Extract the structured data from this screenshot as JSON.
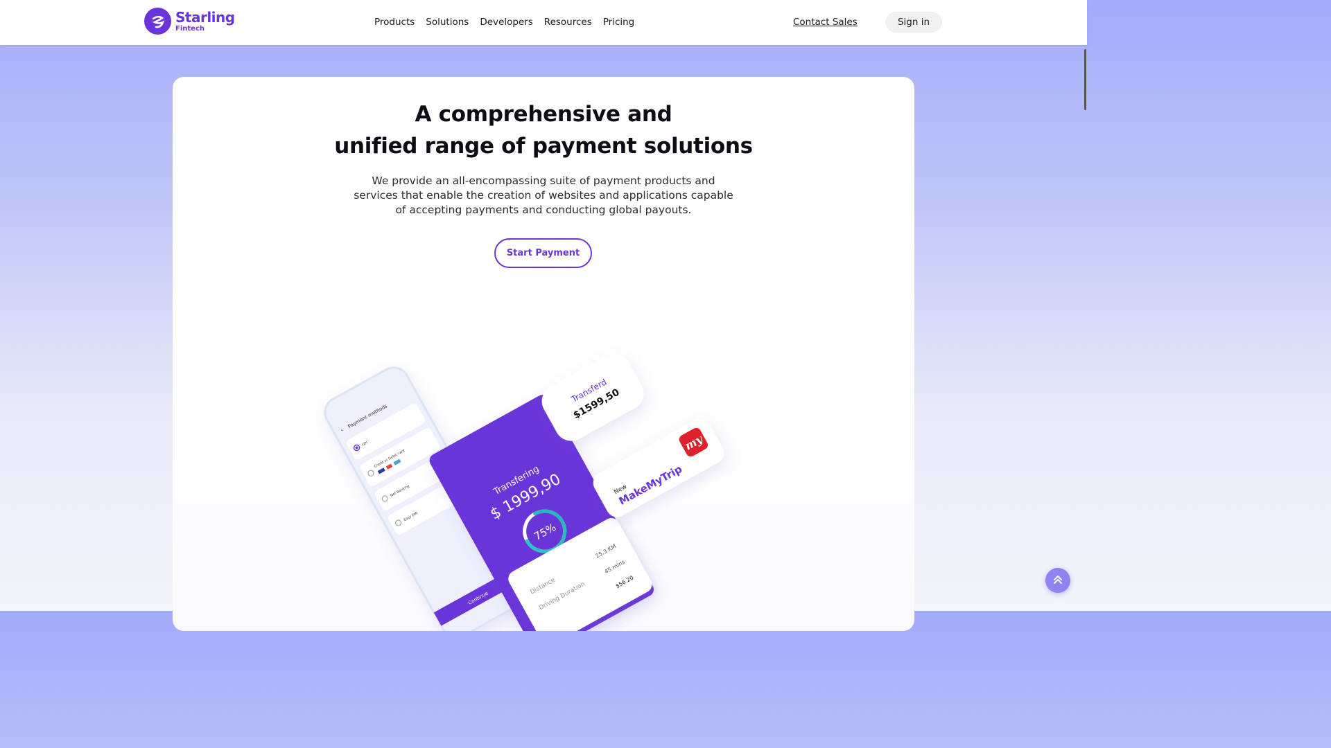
{
  "brand": {
    "name": "Starling",
    "subtitle": "Fintech",
    "accent": "#6a35d8"
  },
  "nav": [
    "Products",
    "Solutions",
    "Developers",
    "Resources",
    "Pricing"
  ],
  "header_actions": {
    "contact": "Contact Sales",
    "signin": "Sign in"
  },
  "hero": {
    "title_line1": "A comprehensive and",
    "title_line2": "unified range of payment solutions",
    "description": "We provide an all-encompassing suite of payment products and services that enable the creation of websites and applications capable of accepting payments and conducting global payouts.",
    "cta": "Start Payment"
  },
  "illustration": {
    "phone": {
      "title": "Payment methods",
      "options": [
        "UPI",
        "Credit or Debit card",
        "Net Banking",
        "Easy EMI"
      ],
      "continue": "Continue"
    },
    "transfer_card": {
      "label": "Transfering",
      "amount": "$ 1999,90",
      "progress_label": "75%",
      "progress": 0.75
    },
    "transferred_card": {
      "label": "Transferd",
      "amount": "$1599,50"
    },
    "merchant_card": {
      "badge": "New",
      "name": "MakeMyTrip",
      "logo_text": "my"
    },
    "trip_details": {
      "rows": [
        {
          "label": "Distance",
          "value": "25.3 KM"
        },
        {
          "label": "Driving Duration",
          "value": "45 mins"
        },
        {
          "label": "",
          "value": "$56.20"
        }
      ]
    }
  },
  "icons": {
    "back_to_top": "chevron-double-up-icon"
  },
  "colors": {
    "primary": "#6a35d8",
    "teal": "#2fc4c9",
    "bg_top": "#a3abfb"
  }
}
